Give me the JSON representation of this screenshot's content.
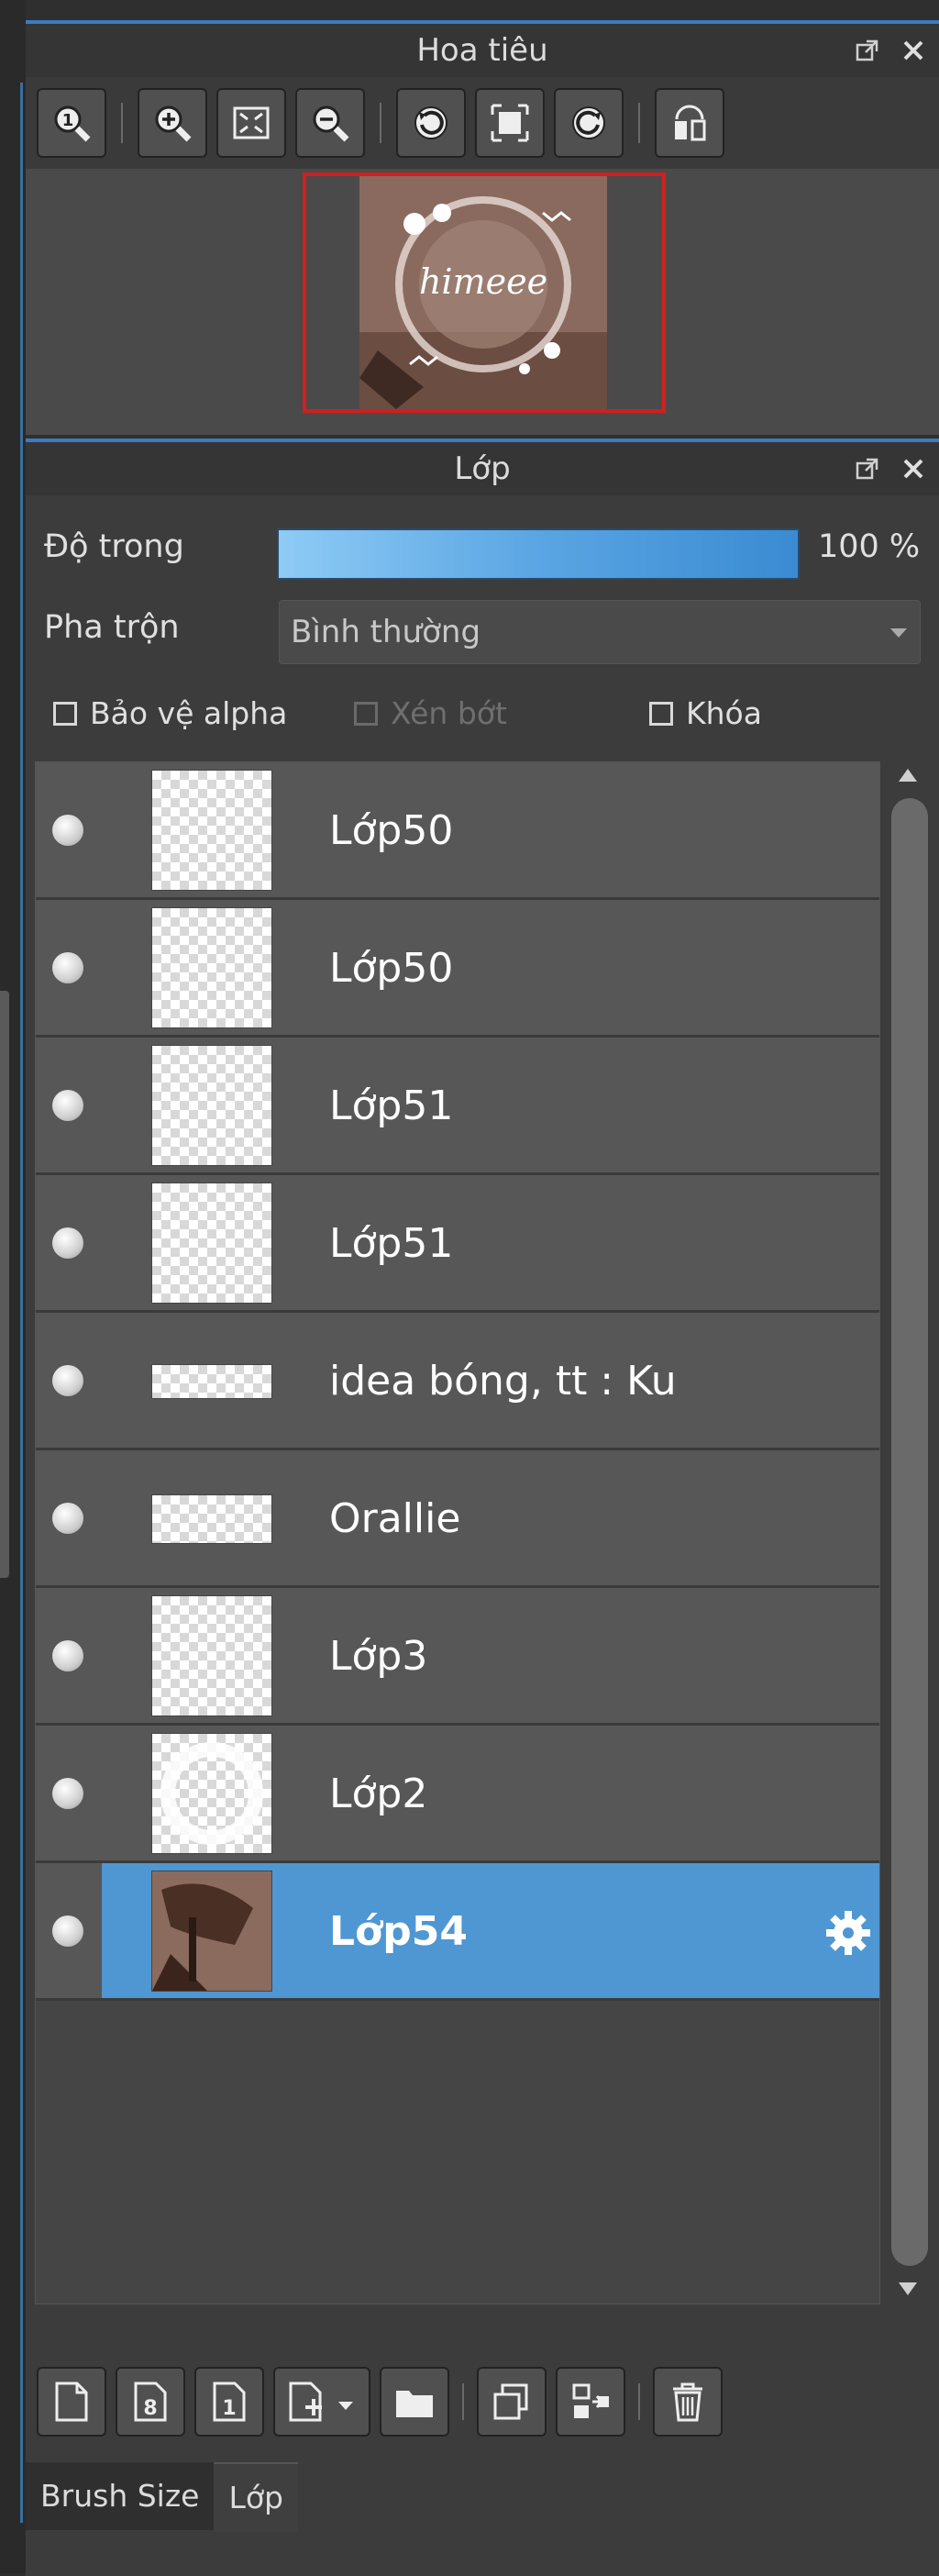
{
  "navigator": {
    "title": "Hoa tiêu",
    "thumbnail_text": "himeee"
  },
  "layers_panel": {
    "title": "Lớp",
    "opacity_label": "Độ trong",
    "opacity_value": "100 %",
    "opacity_fraction": 1.0,
    "blend_label": "Pha trộn",
    "blend_value": "Bình thường",
    "protect_alpha_label": "Bảo vệ alpha",
    "clipping_label": "Xén bớt",
    "lock_label": "Khóa",
    "layers": [
      {
        "name": "Lớp50",
        "selected": false
      },
      {
        "name": "Lớp50",
        "selected": false
      },
      {
        "name": "Lớp51",
        "selected": false
      },
      {
        "name": "Lớp51",
        "selected": false
      },
      {
        "name": "idea bóng, tt : Ku",
        "selected": false
      },
      {
        "name": "Orallie",
        "selected": false
      },
      {
        "name": "Lớp3",
        "selected": false
      },
      {
        "name": "Lớp2",
        "selected": false
      },
      {
        "name": "Lớp54",
        "selected": true
      }
    ]
  },
  "tabs": [
    {
      "label": "Brush Size",
      "active": false
    },
    {
      "label": "Lớp",
      "active": true
    }
  ],
  "colors": {
    "accent": "#3b7cc0",
    "selected_row": "#4f97d2",
    "thumbnail_frame": "#d21f1f"
  }
}
